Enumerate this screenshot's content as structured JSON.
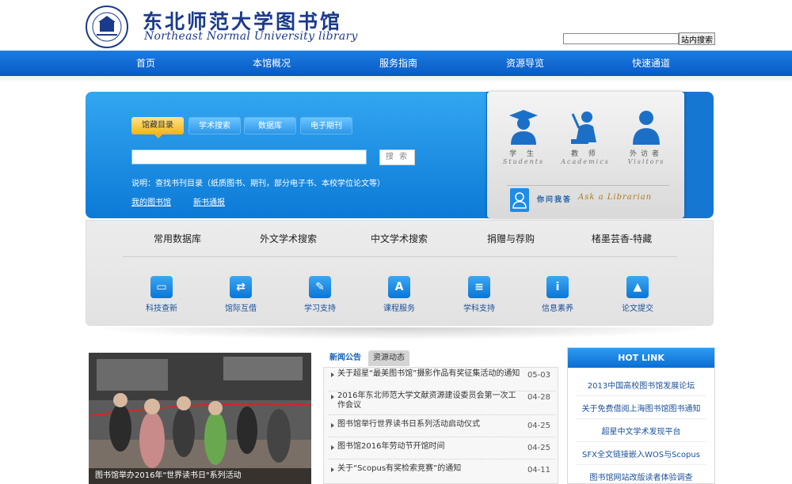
{
  "header": {
    "logo_cn": "东北师范大学图书馆",
    "logo_en": "Northeast Normal University library",
    "seal_text": "NORTHEAST NORMAL UNIVERSITY",
    "site_search_button": "站内搜索"
  },
  "nav": {
    "items": [
      "首页",
      "本馆概况",
      "服务指南",
      "资源导览",
      "快速通道"
    ]
  },
  "search": {
    "tabs": [
      "馆藏目录",
      "学术搜索",
      "数据库",
      "电子期刊"
    ],
    "active_tab": 0,
    "input_value": "",
    "button_label": "搜 索",
    "note": "说明：查找书刊目录（纸质图书、期刊，部分电子书、本校学位论文等）",
    "links": [
      "我的图书馆",
      "新书通报"
    ]
  },
  "users": {
    "groups": [
      {
        "cn": "学 生",
        "en": "Students",
        "icon": "student-icon"
      },
      {
        "cn": "教 师",
        "en": "Academics",
        "icon": "teacher-icon"
      },
      {
        "cn": "外访者",
        "en": "Visitors",
        "icon": "visitor-icon"
      }
    ],
    "ask_cn": "你问我答",
    "ask_en": "Ask a Librarian"
  },
  "services": {
    "links": [
      "常用数据库",
      "外文学术搜索",
      "中文学术搜索",
      "捐赠与荐购",
      "楮墨芸香-特藏"
    ],
    "icons": [
      {
        "label": "科技查新",
        "icon": "monitor-icon",
        "glyph": "▭"
      },
      {
        "label": "馆际互借",
        "icon": "handshake-icon",
        "glyph": "⇄"
      },
      {
        "label": "学习支持",
        "icon": "pencil-icon",
        "glyph": "✎"
      },
      {
        "label": "课程服务",
        "icon": "font-icon",
        "glyph": "A"
      },
      {
        "label": "学科支持",
        "icon": "layers-icon",
        "glyph": "≡"
      },
      {
        "label": "信息素养",
        "icon": "info-icon",
        "glyph": "i"
      },
      {
        "label": "论文提交",
        "icon": "graduation-cap-icon",
        "glyph": "▲"
      }
    ]
  },
  "photo": {
    "caption": "图书馆举办2016年\"世界读书日\"系列活动"
  },
  "news": {
    "tabs": [
      "新闻公告",
      "资源动态"
    ],
    "items": [
      {
        "title": "关于超星“最美图书馆”摄影作品有奖征集活动的通知",
        "date": "05-03"
      },
      {
        "title": "2016年东北师范大学文献资源建设委员会第一次工作会议",
        "date": "04-28"
      },
      {
        "title": "图书馆举行世界读书日系列活动启动仪式",
        "date": "04-25"
      },
      {
        "title": "图书馆2016年劳动节开馆时间",
        "date": "04-25"
      },
      {
        "title": "关于“Scopus有奖检索竞赛”的通知",
        "date": "04-11"
      }
    ]
  },
  "hotlink": {
    "title": "HOT LINK",
    "items": [
      "2013中国高校图书馆发展论坛",
      "关于免费借阅上海图书馆图书通知",
      "超星中文学术发现平台",
      "SFX全文链接嵌入WOS与Scopus",
      "图书馆网站改版读者体验调查"
    ]
  },
  "colors": {
    "brand_blue": "#0a6ed3",
    "active_tab_yellow": "#f2b414",
    "logo_blue": "#1a3a8c"
  }
}
